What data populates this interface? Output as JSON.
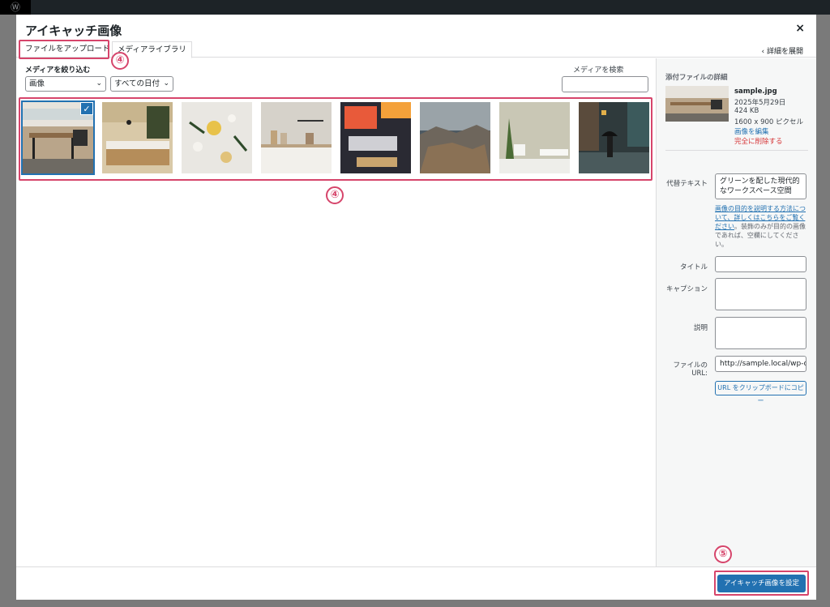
{
  "modal": {
    "title": "アイキャッチ画像",
    "close": "×",
    "expand_details": "‹ 詳細を展開"
  },
  "tabs": [
    {
      "label": "ファイルをアップロード"
    },
    {
      "label": "メディアライブラリ"
    }
  ],
  "filters": {
    "label": "メディアを絞り込む",
    "type_selected": "画像",
    "date_selected": "すべての日付",
    "search_label": "メディアを検索",
    "search_value": ""
  },
  "thumbnails": [
    {
      "icon": "office-workspace-photo",
      "selected": true
    },
    {
      "icon": "cafe-counter-photo",
      "selected": false
    },
    {
      "icon": "pressed-flowers-photo",
      "selected": false
    },
    {
      "icon": "kitchen-shelf-photo",
      "selected": false
    },
    {
      "icon": "keyboard-desk-photo",
      "selected": false
    },
    {
      "icon": "rocky-landscape-photo",
      "selected": false
    },
    {
      "icon": "plant-mug-photo",
      "selected": false
    },
    {
      "icon": "rainy-street-photo",
      "selected": false
    }
  ],
  "details": {
    "heading": "添付ファイルの詳細",
    "filename": "sample.jpg",
    "date": "2025年5月29日",
    "filesize": "424 KB",
    "dimensions": "1600 x 900 ピクセル",
    "edit_link": "画像を編集",
    "delete_link": "完全に削除する",
    "alt_label": "代替テキスト",
    "alt_value": "グリーンを配した現代的なワークスペース空間",
    "alt_help_link": "画像の目的を説明する方法について、詳しくはこちらをご覧ください",
    "alt_help_text": "。装飾のみが目的の画像であれば、空欄にしてください。",
    "title_label": "タイトル",
    "caption_label": "キャプション",
    "description_label": "説明",
    "url_label": "ファイルの URL:",
    "url_value": "http://sample.local/wp-co",
    "copy_button": "URL をクリップボードにコピー"
  },
  "footer": {
    "set_button": "アイキャッチ画像を設定"
  },
  "annotations": {
    "step_upload": "④",
    "step_grid": "④",
    "step_button": "⑤",
    "color": "#d6456b"
  },
  "colors": {
    "accent": "#2271b1",
    "danger": "#d63638"
  }
}
